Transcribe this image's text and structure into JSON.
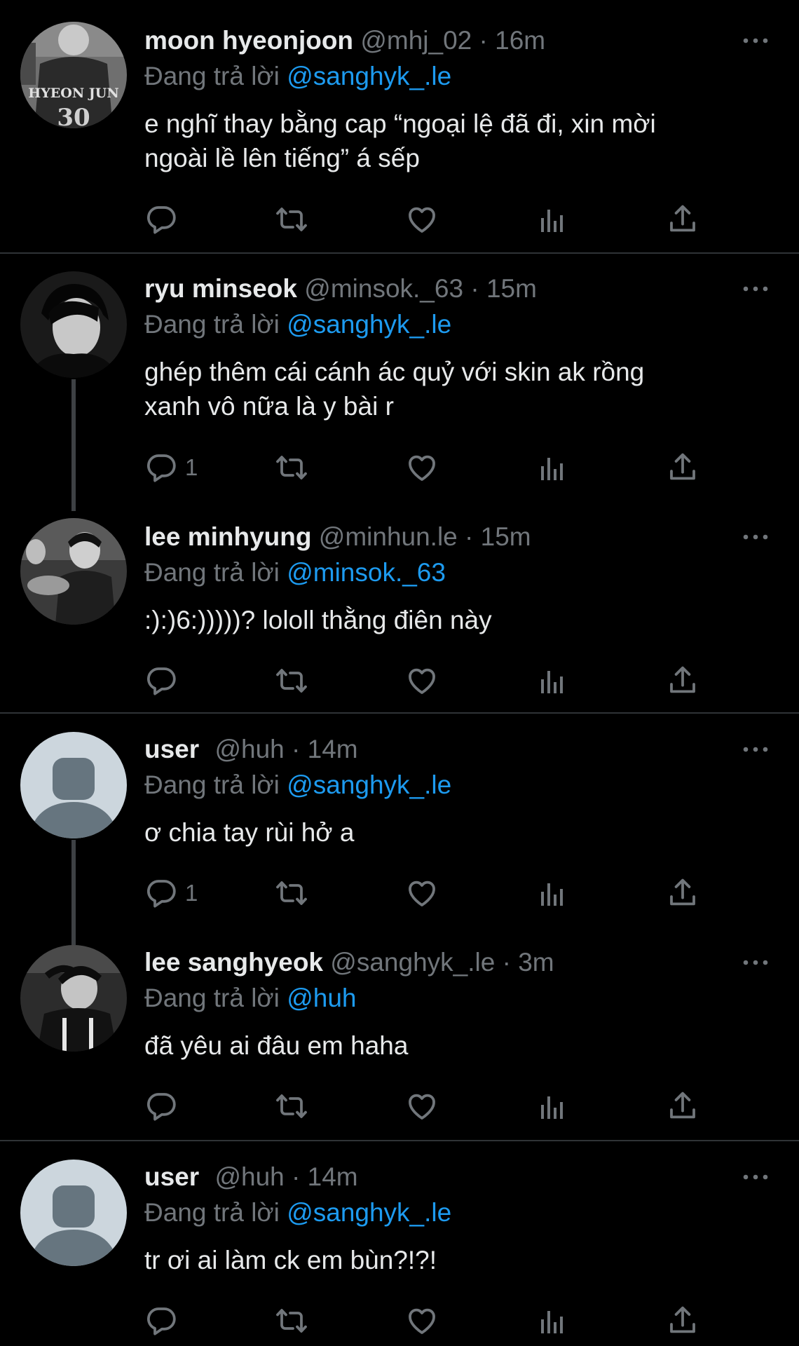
{
  "reply_prefix": "Đang trả lời",
  "tweets": [
    {
      "name": "moon hyeonjoon",
      "handle": "@mhj_02",
      "time": "16m",
      "replying_to": "@sanghyk_.le",
      "text_lines": [
        "e nghĩ thay bằng cap “ngoại lệ đã đi, xin mời",
        "ngoài lề lên tiếng” á sếp"
      ],
      "avatar_text": "HYEON JUN",
      "reply_count": ""
    },
    {
      "name": "ryu minseok",
      "handle": "@minsok._63",
      "time": "15m",
      "replying_to": "@sanghyk_.le",
      "text_lines": [
        "ghép thêm cái cánh ác quỷ với skin ak rồng",
        "xanh vô nữa là y bài r"
      ],
      "reply_count": "1"
    },
    {
      "name": "lee minhyung",
      "handle": "@minhun.le",
      "time": "15m",
      "replying_to": "@minsok._63",
      "text_lines": [
        ":):)6:)))))? lololl thằng điên này"
      ],
      "reply_count": ""
    },
    {
      "name": "user",
      "handle": "@huh",
      "time": "14m",
      "replying_to": "@sanghyk_.le",
      "text_lines": [
        "ơ chia tay rùi hở a"
      ],
      "reply_count": "1"
    },
    {
      "name": "lee sanghyeok",
      "handle": "@sanghyk_.le",
      "time": "3m",
      "replying_to": "@huh",
      "text_lines": [
        "đã yêu ai đâu em haha"
      ],
      "reply_count": ""
    },
    {
      "name": "user",
      "handle": "@huh",
      "time": "14m",
      "replying_to": "@sanghyk_.le",
      "text_lines": [
        "tr ơi ai làm ck em bùn?!?!"
      ],
      "reply_count": ""
    }
  ],
  "icons": [
    "reply-icon",
    "retweet-icon",
    "like-icon",
    "analytics-icon",
    "share-icon",
    "more-icon"
  ],
  "colors": {
    "background": "#000000",
    "text": "#e7e9ea",
    "muted": "#71767b",
    "accent": "#1d9bf0",
    "divider": "#2f3336"
  }
}
